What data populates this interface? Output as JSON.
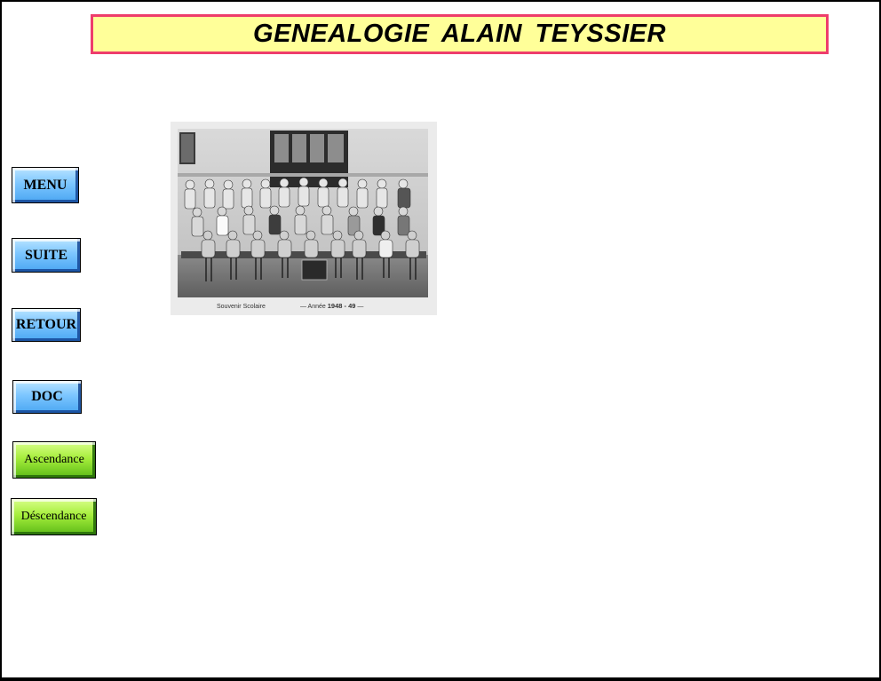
{
  "title": "GENEALOGIE  ALAIN  TEYSSIER",
  "nav": {
    "menu": "MENU",
    "suite": "SUITE",
    "retour": "RETOUR",
    "doc": "DOC",
    "ascendance": "Ascendance",
    "descendance": "Déscendance"
  },
  "photo": {
    "caption_left": "Souvenir Scolaire",
    "caption_right_prefix": "—  Année ",
    "caption_year": "1948 - 49",
    "caption_right_suffix": "  —"
  },
  "colors": {
    "banner_bg": "#ffff99",
    "banner_border": "#ee3d6c",
    "button_blue": "#7cc6ff",
    "button_green": "#a6ee3c"
  }
}
